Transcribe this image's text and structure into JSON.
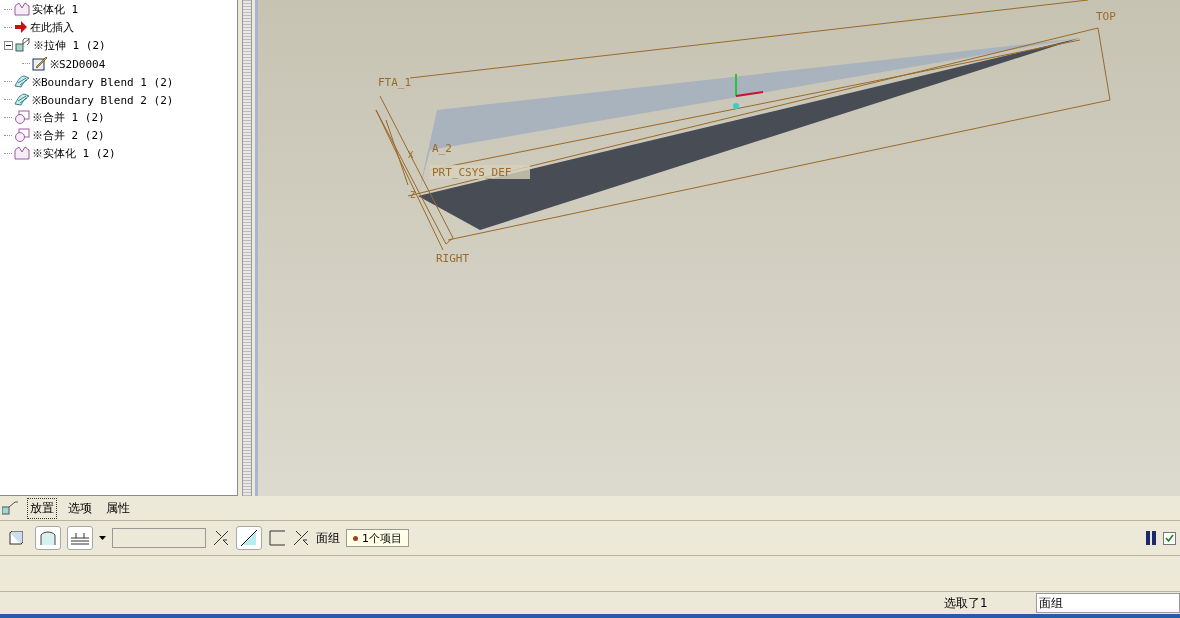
{
  "model_tree": {
    "items": [
      {
        "kind": "solidify",
        "label": "实体化 1"
      },
      {
        "kind": "insert",
        "label": "在此插入"
      },
      {
        "kind": "extrude",
        "label": "※拉伸 1 (2)",
        "expanded": true,
        "children": [
          {
            "kind": "sketch",
            "label": "※S2D0004"
          }
        ]
      },
      {
        "kind": "blend",
        "label": "※Boundary Blend 1 (2)"
      },
      {
        "kind": "blend",
        "label": "※Boundary Blend 2 (2)"
      },
      {
        "kind": "merge",
        "label": "※合并 1 (2)"
      },
      {
        "kind": "merge",
        "label": "※合并 2 (2)"
      },
      {
        "kind": "solidify",
        "label": "※实体化 1 (2)"
      }
    ]
  },
  "viewport": {
    "labels": [
      {
        "kind": "plane",
        "text": "FTA_1"
      },
      {
        "kind": "plane",
        "text": "A_2"
      },
      {
        "kind": "csys",
        "text": "PRT_CSYS_DEF"
      },
      {
        "kind": "plane",
        "text": "RIGHT"
      },
      {
        "kind": "plane",
        "text": "TOP"
      },
      {
        "kind": "axis",
        "text": "X"
      },
      {
        "kind": "axis",
        "text": "Z"
      }
    ]
  },
  "dashboard": {
    "tabs": [
      {
        "label": "放置",
        "selected": true
      },
      {
        "label": "选项",
        "selected": false
      },
      {
        "label": "属性",
        "selected": false
      }
    ],
    "toolbar": {
      "type_buttons": [
        {
          "kind": "solid",
          "selected": false
        },
        {
          "kind": "surface",
          "selected": true
        }
      ],
      "quilt_label": "面组",
      "quilt_collector": "1个项目"
    }
  },
  "status_bar": {
    "message": "选取了1",
    "filter": "面组"
  }
}
